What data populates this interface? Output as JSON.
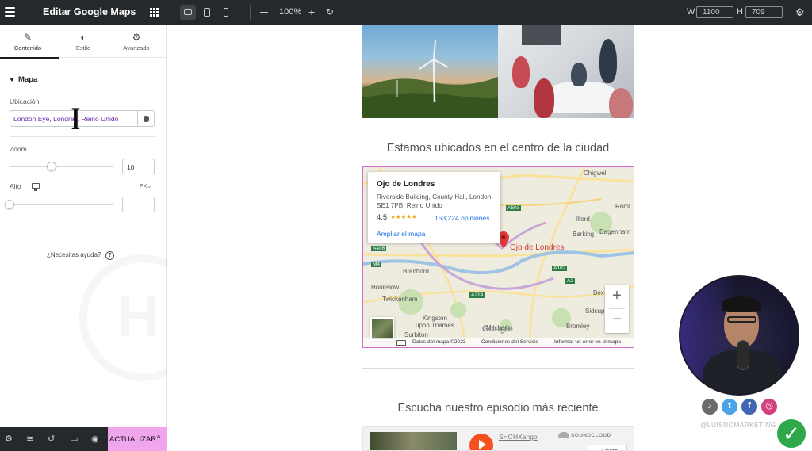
{
  "topbar": {
    "panel_title": "Editar Google Maps",
    "zoom": "100%",
    "zoom_minus": "−",
    "zoom_plus": "+",
    "zoom_reset": "↻",
    "width_label": "W",
    "width_value": "1100",
    "height_label": "H",
    "height_value": "709",
    "gear": "⚙"
  },
  "panel": {
    "tabs": [
      {
        "label": "Contenido",
        "icon": "✎",
        "icon_name": "pencil-icon",
        "active": true
      },
      {
        "label": "Estilo",
        "icon": "◐",
        "icon_name": "half-circle-icon",
        "active": false
      },
      {
        "label": "Avanzado",
        "icon": "⚙",
        "icon_name": "gear-icon",
        "active": false
      }
    ],
    "section_title": "Mapa",
    "location_label": "Ubicación",
    "location_value": "London Eye, Londres, Reino Unido",
    "zoom_label": "Zoom",
    "zoom_value": "10",
    "zoom_level": 0.4,
    "height_label": "Alto",
    "height_unit": "PX⌄",
    "height_value": "",
    "height_level": 0,
    "help_text": "¿Necesitas ayuda?",
    "help_icon": "?",
    "collapse_arrow": "‹"
  },
  "bottombar": {
    "icons": [
      "gear-icon",
      "layers-icon",
      "history-icon",
      "responsive-icon",
      "eye-icon"
    ],
    "icon_glyphs": [
      "⚙",
      "≋",
      "↺",
      "▭",
      "◉"
    ],
    "update_label": "ACTUALIZAR",
    "update_chevron": "^",
    "accent": "#f0a6ec"
  },
  "canvas": {
    "heading_location": "Estamos ubicados en el centro de la ciudad",
    "heading_episode": "Escucha nuestro episodio más reciente",
    "map": {
      "place_name": "Ojo de Londres",
      "address": "Riverside Building, County Hall, London SE1 7PB, Reino Unido",
      "rating": "4.5",
      "stars": "★★★★★",
      "reviews": "153,224 opiniones",
      "enlarge_link": "Ampliar el mapa",
      "marker_label": "Ojo de Londres",
      "labels": {
        "chigwell": "Chigwell",
        "romford": "Romf",
        "ilford": "Ilford",
        "barking": "Barking",
        "dagenham": "Dagenham",
        "brentford": "Brentford",
        "hounslow": "Hounslow",
        "twickenham": "Twickenham",
        "kingston": "Kingston\nupon Thames",
        "surbiton": "Surbiton",
        "mitcham": "Mitcham",
        "bromley": "Bromley",
        "sidcup": "Sidcup",
        "bexley": "Bex",
        "m4": "M4",
        "a406": "A406",
        "a102": "A102",
        "a503": "A503",
        "a214": "A214",
        "a2": "A2"
      },
      "zoom_in": "+",
      "zoom_out": "−",
      "google": "Google",
      "attribution": {
        "data": "Datos del mapa ©2023",
        "terms": "Condiciones del Servicio",
        "report": "Informar un error en el mapa"
      }
    },
    "soundcloud": {
      "user": "SHCHXango",
      "brand": "SOUNDCLOUD",
      "share": "Share"
    }
  },
  "overlay": {
    "handle": "@LUISNOMARKETING",
    "social": [
      {
        "name": "tiktok-icon",
        "glyph": "♪",
        "color": "#6b6b6b"
      },
      {
        "name": "twitter-icon",
        "glyph": "t",
        "color": "#4aa3e8"
      },
      {
        "name": "facebook-icon",
        "glyph": "f",
        "color": "#4267b2"
      },
      {
        "name": "instagram-icon",
        "glyph": "◎",
        "color": "#d2407e"
      }
    ],
    "check": "✓"
  }
}
